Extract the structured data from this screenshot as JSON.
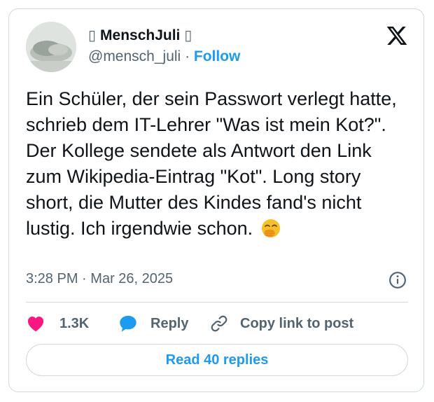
{
  "author": {
    "name": "MenschJuli",
    "name_prefix_glyph": "▯",
    "name_suffix_glyph": "▯",
    "handle": "@mensch_juli",
    "separator": "·",
    "follow_label": "Follow"
  },
  "tweet": {
    "text": "Ein Schüler, der sein Passwort verlegt hatte, schrieb dem IT-Lehrer \"Was ist mein Kot?\". Der Kollege sendete als Antwort den Link zum Wikipedia-Eintrag \"Kot\". Long story short, die Mutter des Kindes fand's nicht lustig. Ich irgendwie schon.",
    "emoji": "face-with-hand-over-mouth",
    "time": "3:28 PM",
    "time_separator": "·",
    "date": "Mar 26, 2025"
  },
  "actions": {
    "like_count": "1.3K",
    "reply_label": "Reply",
    "copy_link_label": "Copy link to post"
  },
  "read_replies_label": "Read 40 replies",
  "icons": {
    "like": "heart-icon",
    "reply": "speech-bubble-icon",
    "copy": "link-icon",
    "info": "info-icon",
    "platform": "x-logo-icon"
  },
  "colors": {
    "accent": "#1d9bf0",
    "like": "#f91880",
    "text": "#0f1419",
    "muted": "#536471",
    "border": "#cfd9de"
  }
}
